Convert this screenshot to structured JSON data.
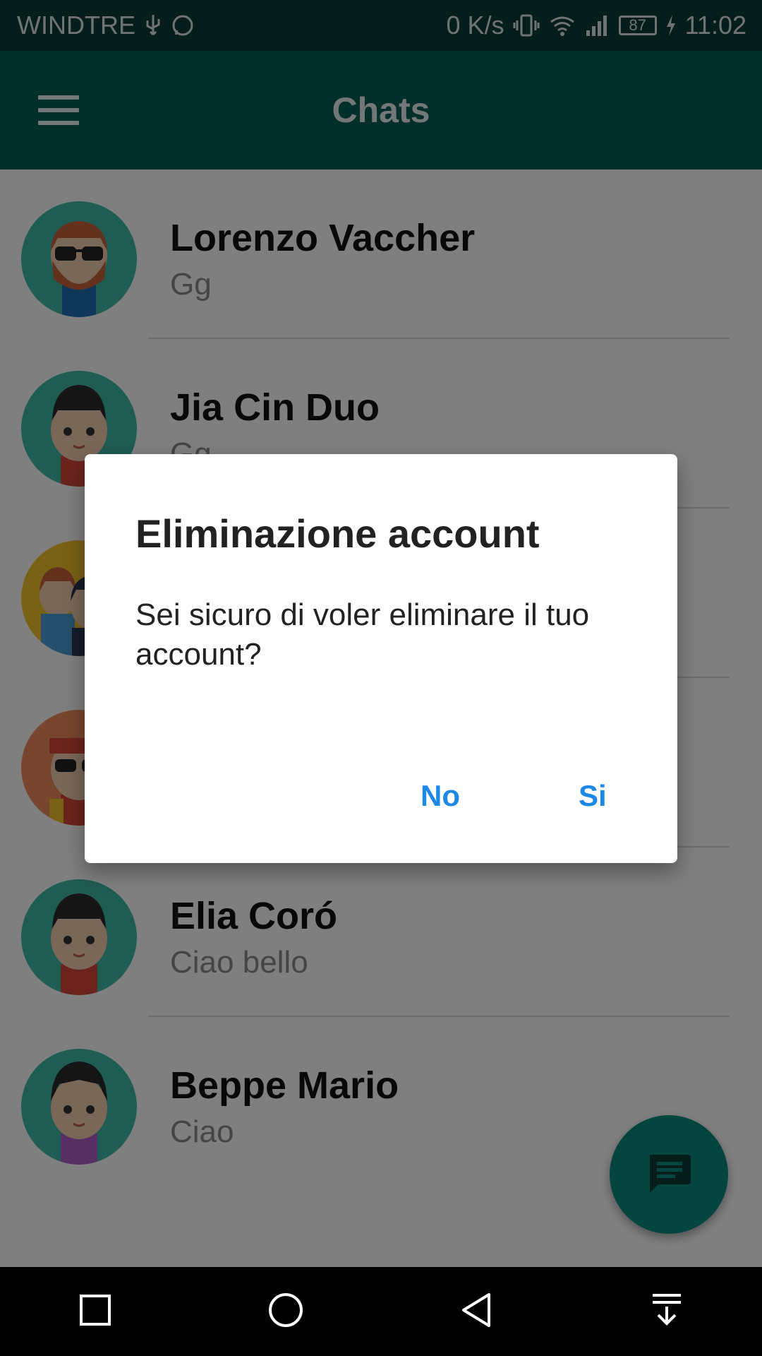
{
  "status_bar": {
    "carrier": "WINDTRE",
    "net_speed": "0 K/s",
    "battery": "87",
    "time": "11:02",
    "icons": [
      "usb-icon",
      "whatsapp-icon",
      "vibrate-icon",
      "wifi-icon",
      "signal-icon",
      "battery-icon",
      "charging-icon"
    ]
  },
  "appbar": {
    "title": "Chats",
    "menu_icon": "hamburger-menu-icon"
  },
  "chats": [
    {
      "name": "Lorenzo Vaccher",
      "message": "Gg",
      "avatar": "avatar-redhead-sunglasses"
    },
    {
      "name": "Jia Cin Duo",
      "message": "Gg",
      "avatar": "avatar-man-black-hair"
    },
    {
      "name": "",
      "message": "",
      "avatar": "avatar-group"
    },
    {
      "name": "",
      "message": "",
      "avatar": "avatar-bandana-sunglasses"
    },
    {
      "name": "Elia Coró",
      "message": "Ciao bello",
      "avatar": "avatar-man-black-hair"
    },
    {
      "name": "Beppe Mario",
      "message": "Ciao",
      "avatar": "avatar-man-slicked-hair"
    }
  ],
  "fab": {
    "icon": "new-chat-icon"
  },
  "dialog": {
    "title": "Eliminazione account",
    "message": "Sei sicuro di voler eliminare il tuo account?",
    "negative_label": "No",
    "positive_label": "Si"
  },
  "colors": {
    "status_bar": "#0b3b36",
    "app_bar": "#075e54",
    "fab": "#0a8a7e",
    "dialog_button": "#1e88e5",
    "avatar_teal": "#3fb8a8"
  },
  "navbar": {
    "icons": [
      "recents-square-icon",
      "home-circle-icon",
      "back-triangle-icon",
      "notification-pull-icon"
    ]
  }
}
